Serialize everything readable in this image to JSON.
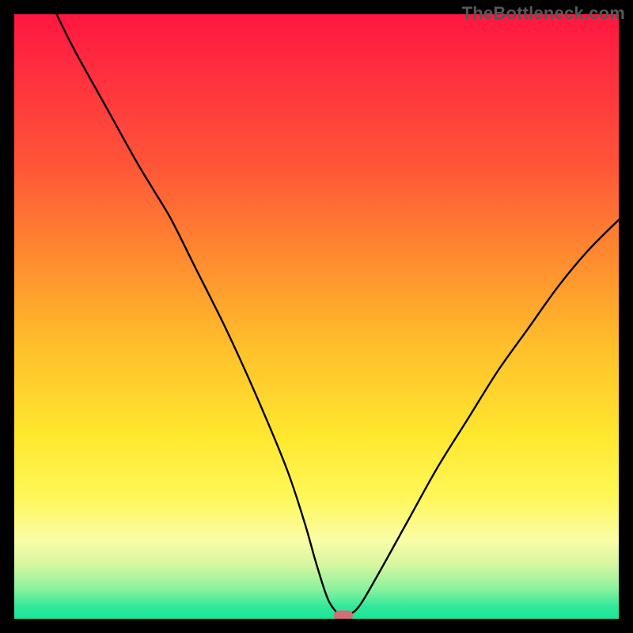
{
  "watermark": "TheBottleneck.com",
  "colors": {
    "background": "#000000",
    "gradient_top": "#ff163f",
    "gradient_bottom": "#18e69b",
    "curve": "#000000",
    "marker": "#d36d76"
  },
  "chart_data": {
    "type": "line",
    "title": "",
    "xlabel": "",
    "ylabel": "",
    "xlim": [
      0,
      100
    ],
    "ylim": [
      0,
      100
    ],
    "grid": false,
    "legend": false,
    "series": [
      {
        "name": "bottleneck-curve",
        "x": [
          7,
          10,
          15,
          20,
          23,
          26,
          30,
          35,
          40,
          45,
          48,
          50,
          52,
          54,
          55,
          57,
          60,
          65,
          70,
          75,
          80,
          85,
          90,
          95,
          100
        ],
        "y": [
          100,
          94,
          85,
          76,
          71,
          66,
          58,
          48,
          37,
          25,
          16,
          9,
          3,
          0.5,
          0.5,
          2,
          7,
          16,
          25,
          33,
          41,
          48,
          55,
          61,
          66
        ]
      }
    ],
    "annotations": [
      {
        "name": "optimal-marker",
        "x": 54.5,
        "y": 0.5
      }
    ]
  }
}
